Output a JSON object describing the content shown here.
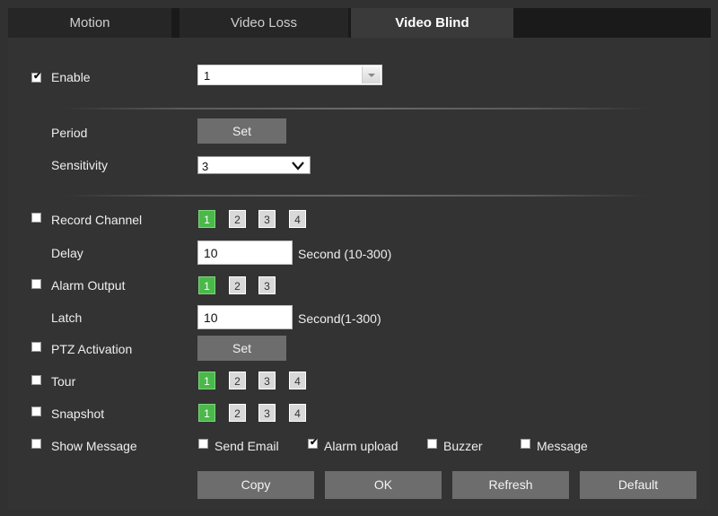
{
  "tabs": [
    {
      "label": "Motion"
    },
    {
      "label": "Video Loss"
    },
    {
      "label": "Video Blind"
    }
  ],
  "enable": {
    "label": "Enable",
    "checked": true,
    "channel_value": "1"
  },
  "period": {
    "label": "Period",
    "button": "Set"
  },
  "sensitivity": {
    "label": "Sensitivity",
    "value": "3"
  },
  "record_channel": {
    "label": "Record Channel",
    "channels": [
      "1",
      "2",
      "3",
      "4"
    ]
  },
  "delay": {
    "label": "Delay",
    "value": "10",
    "unit": "Second (10-300)"
  },
  "alarm_output": {
    "label": "Alarm Output",
    "channels": [
      "1",
      "2",
      "3"
    ]
  },
  "latch": {
    "label": "Latch",
    "value": "10",
    "unit": "Second(1-300)"
  },
  "ptz_activation": {
    "label": "PTZ Activation",
    "button": "Set"
  },
  "tour": {
    "label": "Tour",
    "channels": [
      "1",
      "2",
      "3",
      "4"
    ]
  },
  "snapshot": {
    "label": "Snapshot",
    "channels": [
      "1",
      "2",
      "3",
      "4"
    ]
  },
  "show_message": {
    "label": "Show Message"
  },
  "send_email": {
    "label": "Send Email"
  },
  "alarm_upload": {
    "label": "Alarm upload"
  },
  "buzzer": {
    "label": "Buzzer"
  },
  "message": {
    "label": "Message"
  },
  "actions": {
    "copy": "Copy",
    "ok": "OK",
    "refresh": "Refresh",
    "default": "Default"
  },
  "colors": {
    "active_channel": "#4ab94a",
    "button_bg": "#6d6d6d",
    "panel_bg": "#333333"
  }
}
